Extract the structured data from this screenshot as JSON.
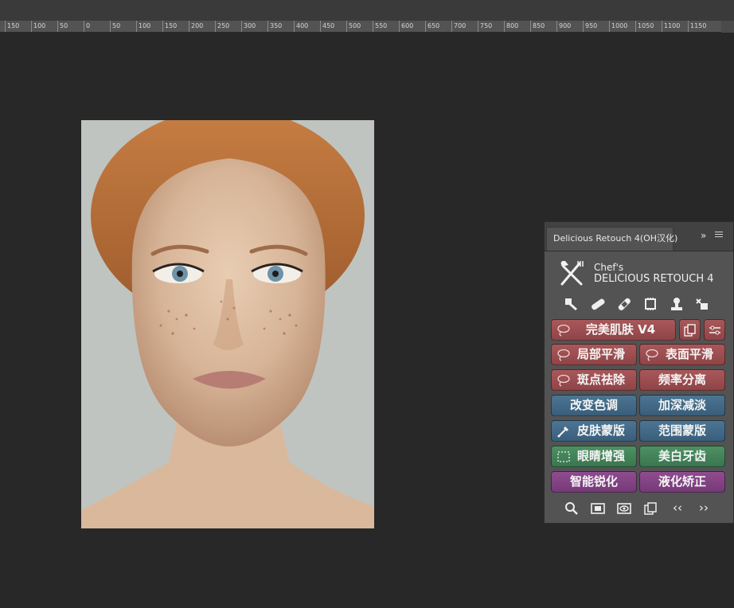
{
  "ruler": {
    "labels": [
      "150",
      "100",
      "50",
      "0",
      "50",
      "100",
      "150",
      "200",
      "250",
      "300",
      "350",
      "400",
      "450",
      "500",
      "550",
      "600",
      "650",
      "700",
      "750",
      "800",
      "850",
      "900",
      "950",
      "1000",
      "1050",
      "1100",
      "1150"
    ]
  },
  "panel": {
    "tab_title": "Delicious Retouch 4(OH汉化)",
    "collapse_glyph": "»",
    "brand_line1": "Chef's",
    "brand_line2": "DELICIOUS RETOUCH 4",
    "tools": [
      "healing-brush-icon",
      "bandage-icon",
      "bandage-alt-icon",
      "chip-icon",
      "stamp-icon",
      "patch-icon"
    ],
    "buttons": {
      "perfect_skin": "完美肌肤 V4",
      "local_smooth": "局部平滑",
      "surface_smooth": "表面平滑",
      "spot_removal": "斑点祛除",
      "freq_separation": "频率分离",
      "change_color": "改变色调",
      "dodge_burn": "加深减淡",
      "skin_mask": "皮肤蒙版",
      "range_mask": "范围蒙版",
      "eye_enhance": "眼睛增强",
      "teeth_whiten": "美白牙齿",
      "smart_sharpen": "智能锐化",
      "liquify_fix": "液化矫正"
    },
    "footer": {
      "prev_label": "‹‹",
      "next_label": "››"
    }
  },
  "colors": {
    "canvas": "#282828",
    "panel": "#535353",
    "red_button": "#9b4e51",
    "blue_button": "#436a87",
    "green_button": "#448259",
    "purple_button": "#834384"
  }
}
